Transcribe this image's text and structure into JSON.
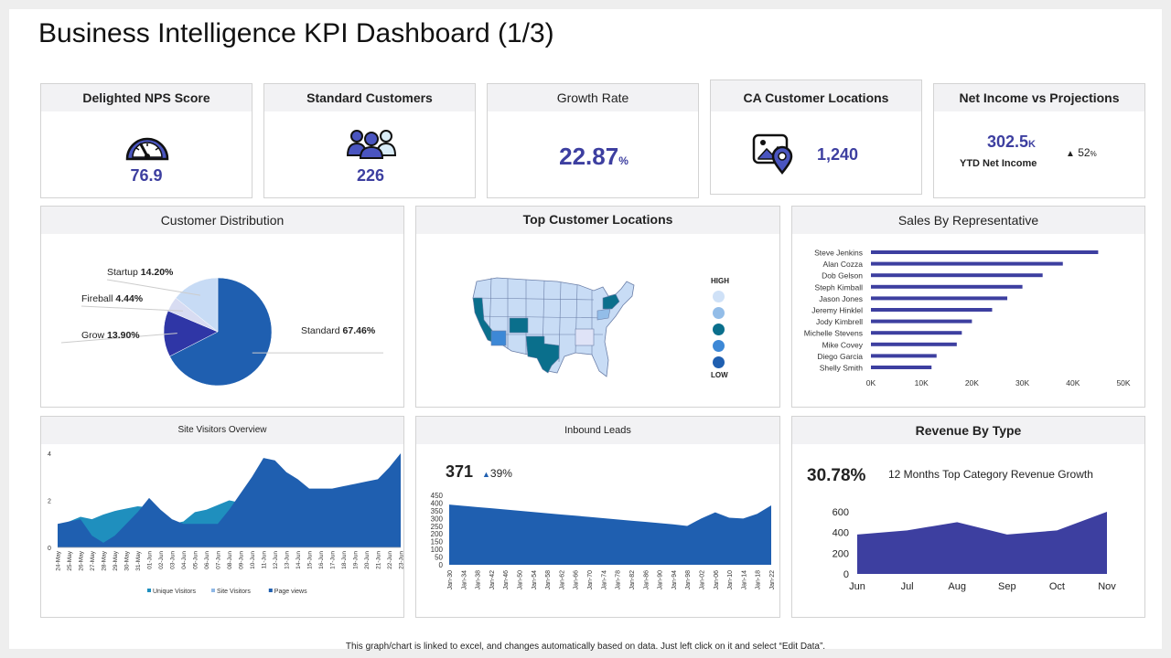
{
  "page": {
    "title": "Business Intelligence KPI Dashboard (1/3)",
    "footer": "This graph/chart is linked to excel, and changes automatically based on data. Just left click on it and select “Edit Data”."
  },
  "kpis": {
    "nps": {
      "title": "Delighted NPS Score",
      "value": "76.9",
      "icon": "speedometer-icon"
    },
    "customers": {
      "title": "Standard Customers",
      "value": "226",
      "icon": "users-group-icon"
    },
    "growth": {
      "title": "Growth Rate",
      "value": "22.87",
      "unit": "%"
    },
    "locations": {
      "title": "CA Customer Locations",
      "value": "1,240",
      "icon": "map-pin-icon"
    },
    "income": {
      "title": "Net Income vs Projections",
      "value": "302.5",
      "unit": "K",
      "label": "YTD Net Income",
      "change_arrow": "▲",
      "change": "52",
      "change_unit": "%"
    }
  },
  "colors": {
    "accent": "#3d3fa0",
    "primary_blue": "#1f5fb0",
    "teal": "#1f8fbe",
    "navy": "#2b2bb8",
    "map_highlight": "#0a6f8c",
    "map_light": "#c8dcf5"
  },
  "map_card": {
    "title": "Top Customer Locations",
    "legend_high": "HIGH",
    "legend_low": "LOW",
    "legend_colors": [
      "#cfe1f7",
      "#93bde8",
      "#0a6f8c",
      "#3d88d6",
      "#1f5fb0"
    ]
  },
  "chart_data": [
    {
      "id": "customer-distribution",
      "type": "pie",
      "title": "Customer Distribution",
      "slices": [
        {
          "label": "Standard",
          "value": 67.46,
          "display": "67.46%",
          "color": "#1f5fb0"
        },
        {
          "label": "Grow",
          "value": 13.9,
          "display": "13.90%",
          "color": "#2f36a6"
        },
        {
          "label": "Fireball",
          "value": 4.44,
          "display": "4.44%",
          "color": "#d8dcf2"
        },
        {
          "label": "Startup",
          "value": 14.2,
          "display": "14.20%",
          "color": "#c7dbf5"
        }
      ]
    },
    {
      "id": "sales-by-representative",
      "type": "bar",
      "orientation": "horizontal",
      "title": "Sales By Representative",
      "categories": [
        "Steve Jenkins",
        "Alan Cozza",
        "Dob Gelson",
        "Steph Kimball",
        "Jason Jones",
        "Jeremy Hinklel",
        "Jody Kimbrell",
        "Michelle Stevens",
        "Mike Covey",
        "Diego Garcia",
        "Shelly Smith"
      ],
      "values": [
        45000,
        38000,
        34000,
        30000,
        27000,
        24000,
        20000,
        18000,
        17000,
        13000,
        12000
      ],
      "xlim": [
        0,
        50000
      ],
      "xticks": [
        0,
        10000,
        20000,
        30000,
        40000,
        50000
      ],
      "xtick_labels": [
        "0K",
        "10K",
        "20K",
        "30K",
        "40K",
        "50K"
      ],
      "color": "#3d3fa0"
    },
    {
      "id": "site-visitors-overview",
      "type": "area",
      "title": "Site Visitors Overview",
      "categories": [
        "24-May",
        "25-May",
        "26-May",
        "27-May",
        "28-May",
        "29-May",
        "30-May",
        "31-May",
        "01-Jun",
        "02-Jun",
        "03-Jun",
        "04-Jun",
        "05-Jun",
        "06-Jun",
        "07-Jun",
        "08-Jun",
        "09-Jun",
        "10-Jun",
        "11-Jun",
        "12-Jun",
        "13-Jun",
        "14-Jun",
        "15-Jun",
        "16-Jun",
        "17-Jun",
        "18-Jun",
        "19-Jun",
        "20-Jun",
        "21-Jun",
        "22-Jun",
        "23-Jun"
      ],
      "series": [
        {
          "name": "Unique Visitors",
          "color": "#1f8fbe",
          "values": [
            0.9,
            1.1,
            1.3,
            1.2,
            1.4,
            1.55,
            1.65,
            1.75,
            1.7,
            1.2,
            1.0,
            1.1,
            1.5,
            1.6,
            1.8,
            2.0,
            1.9,
            2.1,
            2.4,
            2.3,
            2.2,
            2.1,
            2.0,
            2.0,
            2.1,
            2.2,
            2.3,
            2.4,
            2.5,
            2.6,
            3.0
          ]
        },
        {
          "name": "Site Visitors",
          "color": "#8fb8e6",
          "values": [
            0,
            0,
            0,
            0,
            0,
            0,
            0,
            0,
            0,
            0,
            0,
            0,
            0,
            0,
            0,
            0,
            0,
            0,
            0,
            0,
            0,
            0,
            0,
            0,
            0,
            0,
            0,
            0,
            0,
            0,
            0
          ]
        },
        {
          "name": "Page views",
          "color": "#1f5fb0",
          "values": [
            1.0,
            1.1,
            1.2,
            0.5,
            0.2,
            0.5,
            1.0,
            1.5,
            2.1,
            1.6,
            1.2,
            1.0,
            1.0,
            1.0,
            1.0,
            1.6,
            2.3,
            3.0,
            3.8,
            3.7,
            3.2,
            2.9,
            2.5,
            2.5,
            2.5,
            2.6,
            2.7,
            2.8,
            2.9,
            3.4,
            4.0
          ]
        }
      ],
      "ylim": [
        0,
        4
      ],
      "yticks": [
        0,
        2,
        4
      ]
    },
    {
      "id": "inbound-leads",
      "type": "area",
      "title": "Inbound Leads",
      "headline": "371",
      "change_arrow": "▲",
      "change": "39%",
      "categories": [
        "Jan-30",
        "Jan-34",
        "Jan-38",
        "Jan-42",
        "Jan-46",
        "Jan-50",
        "Jan-54",
        "Jan-58",
        "Jan-62",
        "Jan-66",
        "Jan-70",
        "Jan-74",
        "Jan-78",
        "Jan-82",
        "Jan-86",
        "Jan-90",
        "Jan-94",
        "Jan-98",
        "Jan-02",
        "Jan-06",
        "Jan-10",
        "Jan-14",
        "Jan-18",
        "Jan-22"
      ],
      "values": [
        390,
        382,
        374,
        366,
        358,
        350,
        342,
        334,
        326,
        318,
        310,
        302,
        294,
        286,
        278,
        270,
        262,
        252,
        300,
        340,
        305,
        300,
        330,
        385
      ],
      "ylim": [
        0,
        450
      ],
      "yticks": [
        0,
        50,
        100,
        150,
        200,
        250,
        300,
        350,
        400,
        450
      ],
      "color": "#1f5fb0"
    },
    {
      "id": "revenue-by-type",
      "type": "area",
      "title": "Revenue By Type",
      "headline": "30.78%",
      "subtitle": "12 Months Top Category Revenue Growth",
      "categories": [
        "Jun",
        "Jul",
        "Aug",
        "Sep",
        "Oct",
        "Nov"
      ],
      "values": [
        380,
        420,
        500,
        380,
        420,
        600
      ],
      "ylim": [
        0,
        600
      ],
      "yticks": [
        0,
        200,
        400,
        600
      ],
      "color": "#3d3fa0"
    }
  ]
}
